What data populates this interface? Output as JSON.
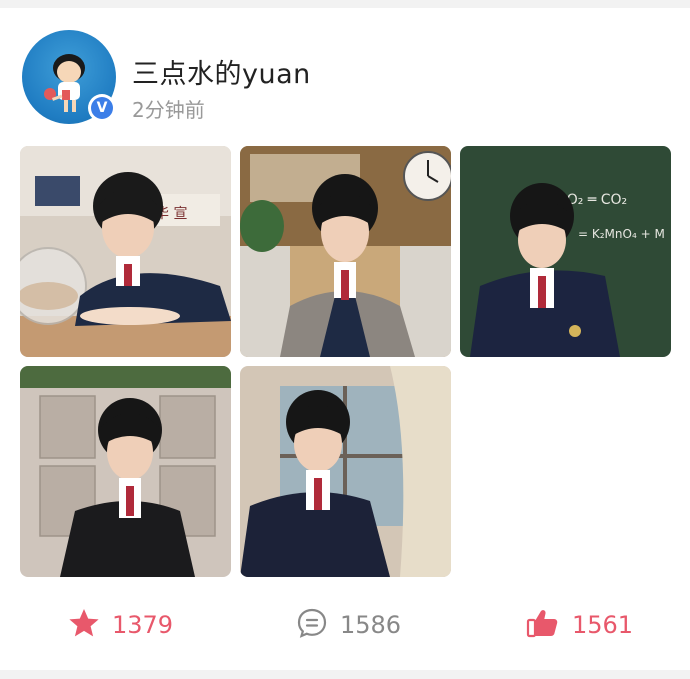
{
  "post": {
    "username": "三点水的yuan",
    "time": "2分钟前",
    "verified_badge": "V",
    "photos": [
      {
        "name": "photo-1",
        "scene": "classroom-desk-fishbowl"
      },
      {
        "name": "photo-2",
        "scene": "classroom-clock-coat"
      },
      {
        "name": "photo-3",
        "scene": "blackboard-formula"
      },
      {
        "name": "photo-4",
        "scene": "lockers"
      },
      {
        "name": "photo-5",
        "scene": "window-curtain"
      }
    ],
    "blackboard_text": [
      "+O₂ ═ CO₂",
      "= K₂MnO₄ + M"
    ],
    "actions": {
      "favorite_count": "1379",
      "comment_count": "1586",
      "like_count": "1561"
    }
  },
  "colors": {
    "accent_red": "#e8586b",
    "verified_blue": "#3b7ee8",
    "muted_gray": "#888888"
  },
  "icons": {
    "favorite": "star-icon",
    "comment": "comment-icon",
    "like": "thumbs-up-icon",
    "verified": "verified-badge-icon"
  }
}
